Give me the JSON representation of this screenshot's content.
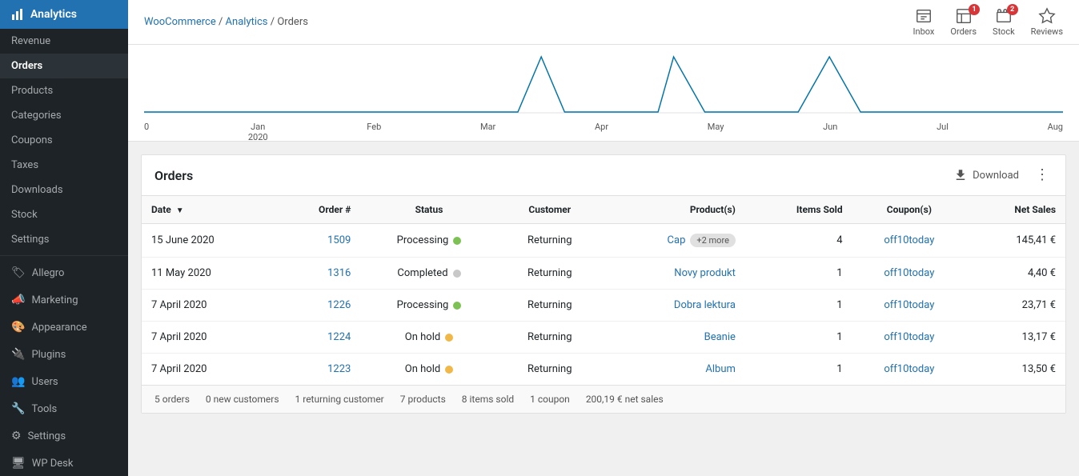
{
  "sidebar": {
    "logo": {
      "text": "Analytics",
      "icon": "chart-icon"
    },
    "nav_items": [
      {
        "id": "revenue",
        "label": "Revenue",
        "active": false,
        "bold": false
      },
      {
        "id": "orders",
        "label": "Orders",
        "active": true,
        "bold": true
      },
      {
        "id": "products",
        "label": "Products",
        "active": false,
        "bold": false
      },
      {
        "id": "categories",
        "label": "Categories",
        "active": false,
        "bold": false
      },
      {
        "id": "coupons",
        "label": "Coupons",
        "active": false,
        "bold": false
      },
      {
        "id": "taxes",
        "label": "Taxes",
        "active": false,
        "bold": false
      },
      {
        "id": "downloads",
        "label": "Downloads",
        "active": false,
        "bold": false
      },
      {
        "id": "stock",
        "label": "Stock",
        "active": false,
        "bold": false
      },
      {
        "id": "settings",
        "label": "Settings",
        "active": false,
        "bold": false
      }
    ],
    "section_items": [
      {
        "id": "allegro",
        "label": "Allegro",
        "icon": "tag-icon"
      },
      {
        "id": "marketing",
        "label": "Marketing",
        "icon": "megaphone-icon"
      },
      {
        "id": "appearance",
        "label": "Appearance",
        "icon": "palette-icon"
      },
      {
        "id": "plugins",
        "label": "Plugins",
        "icon": "plugin-icon"
      },
      {
        "id": "users",
        "label": "Users",
        "icon": "people-icon"
      },
      {
        "id": "tools",
        "label": "Tools",
        "icon": "wrench-icon"
      },
      {
        "id": "settings_main",
        "label": "Settings",
        "icon": "gear-icon"
      },
      {
        "id": "wpdesk",
        "label": "WP Desk",
        "icon": "wpdesk-icon"
      }
    ]
  },
  "topbar": {
    "breadcrumb": {
      "parts": [
        "WooCommerce",
        "Analytics",
        "Orders"
      ],
      "links": [
        "WooCommerce",
        "Analytics"
      ]
    },
    "icons": [
      {
        "id": "inbox",
        "label": "Inbox",
        "icon": "inbox-icon",
        "badge": null
      },
      {
        "id": "orders",
        "label": "Orders",
        "icon": "orders-icon",
        "badge": "1"
      },
      {
        "id": "stock",
        "label": "Stock",
        "icon": "stock-icon",
        "badge": "2"
      },
      {
        "id": "reviews",
        "label": "Reviews",
        "icon": "reviews-icon",
        "badge": null
      }
    ]
  },
  "chart": {
    "labels": [
      "0",
      "Jan\n2020",
      "Feb",
      "Mar",
      "Apr",
      "May",
      "Jun",
      "Jul",
      "Aug"
    ],
    "x_positions": [
      0,
      8,
      19,
      31,
      42,
      54,
      65,
      77,
      88
    ],
    "peaks": [
      {
        "x": 52,
        "height": 70
      },
      {
        "x": 63,
        "height": 55
      },
      {
        "x": 76,
        "height": 45
      }
    ]
  },
  "orders_section": {
    "title": "Orders",
    "download_label": "Download",
    "columns": [
      {
        "id": "date",
        "label": "Date",
        "sortable": true,
        "sort": "desc"
      },
      {
        "id": "order_num",
        "label": "Order #",
        "align": "right"
      },
      {
        "id": "status",
        "label": "Status",
        "align": "center"
      },
      {
        "id": "customer",
        "label": "Customer",
        "align": "center"
      },
      {
        "id": "products",
        "label": "Product(s)",
        "align": "right"
      },
      {
        "id": "items_sold",
        "label": "Items Sold",
        "align": "right"
      },
      {
        "id": "coupons",
        "label": "Coupon(s)",
        "align": "center"
      },
      {
        "id": "net_sales",
        "label": "Net Sales",
        "align": "right"
      }
    ],
    "rows": [
      {
        "date": "15 June 2020",
        "order_num": "1509",
        "status": "Processing",
        "status_type": "processing",
        "customer": "Returning",
        "product_name": "Cap",
        "product_link": true,
        "more": "+2 more",
        "items_sold": "4",
        "coupon": "off10today",
        "net_sales": "145,41 €"
      },
      {
        "date": "11 May 2020",
        "order_num": "1316",
        "status": "Completed",
        "status_type": "completed",
        "customer": "Returning",
        "product_name": "Novy produkt",
        "product_link": true,
        "more": null,
        "items_sold": "1",
        "coupon": "off10today",
        "net_sales": "4,40 €"
      },
      {
        "date": "7 April 2020",
        "order_num": "1226",
        "status": "Processing",
        "status_type": "processing",
        "customer": "Returning",
        "product_name": "Dobra lektura",
        "product_link": true,
        "more": null,
        "items_sold": "1",
        "coupon": "off10today",
        "net_sales": "23,71 €"
      },
      {
        "date": "7 April 2020",
        "order_num": "1224",
        "status": "On hold",
        "status_type": "on-hold",
        "customer": "Returning",
        "product_name": "Beanie",
        "product_link": true,
        "more": null,
        "items_sold": "1",
        "coupon": "off10today",
        "net_sales": "13,17 €"
      },
      {
        "date": "7 April 2020",
        "order_num": "1223",
        "status": "On hold",
        "status_type": "on-hold",
        "customer": "Returning",
        "product_name": "Album",
        "product_link": true,
        "more": null,
        "items_sold": "1",
        "coupon": "off10today",
        "net_sales": "13,50 €"
      }
    ],
    "footer": {
      "orders": "5 orders",
      "new_customers": "0 new customers",
      "returning": "1 returning customer",
      "products": "7 products",
      "items": "8 items sold",
      "coupons": "1 coupon",
      "net_sales": "200,19 € net sales"
    }
  }
}
